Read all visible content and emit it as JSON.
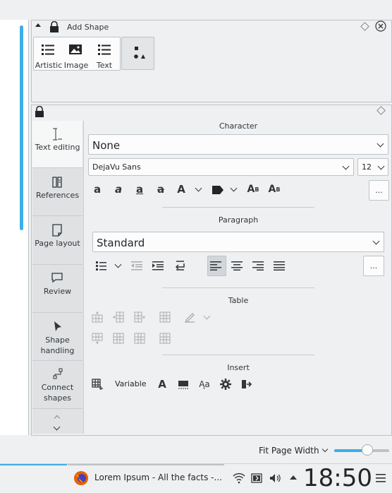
{
  "add_shape": {
    "title": "Add Shape",
    "tools": [
      {
        "label": "Artistic",
        "icon": "list-icon"
      },
      {
        "label": "Image",
        "icon": "image-icon"
      },
      {
        "label": "Text",
        "icon": "text-list-icon"
      }
    ]
  },
  "tabs": [
    {
      "label": "Text editing",
      "icon": "text-cursor-icon"
    },
    {
      "label": "References",
      "icon": "references-icon"
    },
    {
      "label": "Page layout",
      "icon": "page-icon"
    },
    {
      "label": "Review",
      "icon": "comment-icon"
    },
    {
      "label": "Shape handling",
      "icon": "pointer-icon"
    },
    {
      "label": "Connect shapes",
      "icon": "connect-icon"
    }
  ],
  "character": {
    "title": "Character",
    "style": "None",
    "font": "DejaVu Sans",
    "size": "12",
    "more": "..."
  },
  "paragraph": {
    "title": "Paragraph",
    "style": "Standard",
    "more": "..."
  },
  "table": {
    "title": "Table"
  },
  "insert": {
    "title": "Insert",
    "variable": "Variable"
  },
  "status": {
    "zoom": "Fit Page Width",
    "zoom_level": 0.6
  },
  "taskbar": {
    "window": "Lorem Ipsum - All the facts -...",
    "clock": "18:50"
  },
  "colors": {
    "accent": "#3daee9",
    "firefox": "#e66000"
  }
}
